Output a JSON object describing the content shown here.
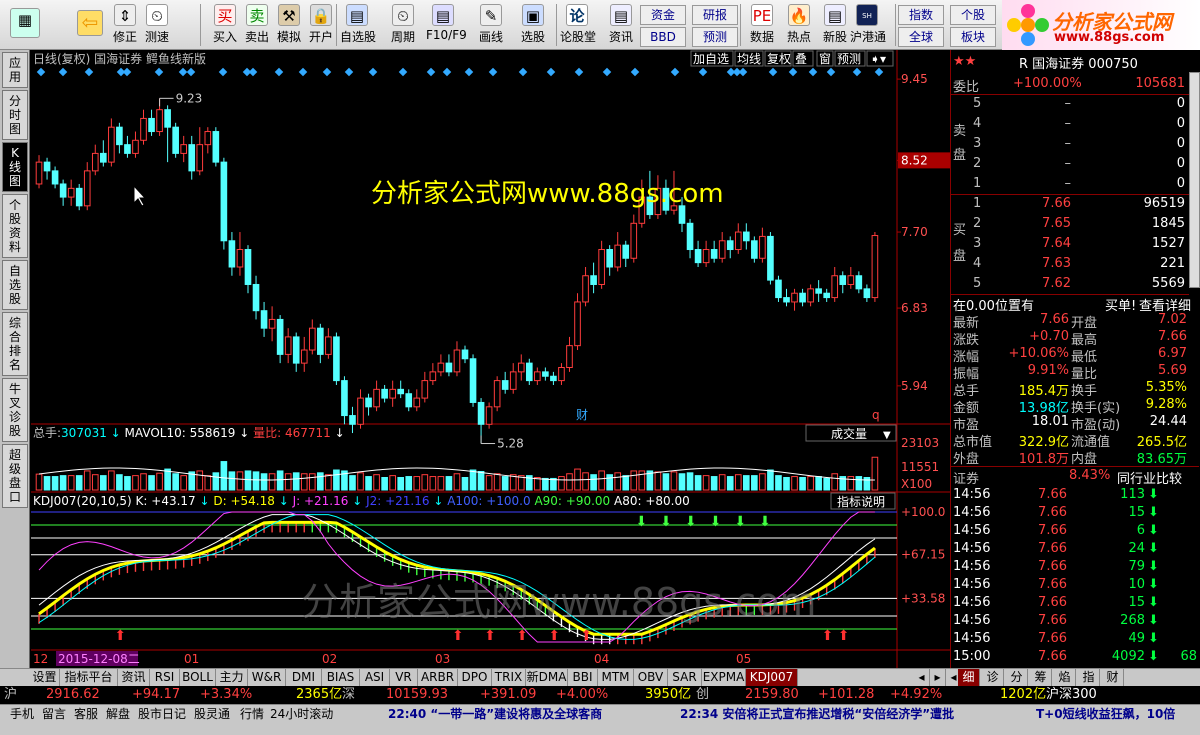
{
  "toolbar": {
    "buttons": [
      {
        "label": "",
        "icon": "layout-icon"
      },
      {
        "label": "",
        "icon": "back-arrow-icon"
      },
      {
        "label": "修正",
        "icon": "up-down-icon"
      },
      {
        "label": "测速",
        "icon": "clock-icon"
      },
      {
        "label": "买入",
        "icon": "buy-icon",
        "glyph": "买"
      },
      {
        "label": "卖出",
        "icon": "sell-icon",
        "glyph": "卖"
      },
      {
        "label": "模拟",
        "icon": "hammer-icon"
      },
      {
        "label": "开户",
        "icon": "lock-icon"
      },
      {
        "label": "自选股",
        "icon": "watchlist-icon"
      },
      {
        "label": "周期",
        "icon": "period-clock-icon"
      },
      {
        "label": "F10/F9",
        "icon": "f10-icon"
      },
      {
        "label": "画线",
        "icon": "pen-icon"
      },
      {
        "label": "选股",
        "icon": "screen-icon"
      },
      {
        "label": "论股堂",
        "icon": "forum-icon",
        "glyph": "论"
      },
      {
        "label": "资讯",
        "icon": "news-icon"
      },
      {
        "label": "数据",
        "icon": "pe-data-icon",
        "glyph": "PE"
      },
      {
        "label": "热点",
        "icon": "hot-icon"
      },
      {
        "label": "新股",
        "icon": "new-stock-icon"
      },
      {
        "label": "沪港通",
        "icon": "hk-connect-icon",
        "glyph": "SH HK"
      }
    ],
    "small": [
      "资金",
      "BBD",
      "研报",
      "预测",
      "指数",
      "全球",
      "个股",
      "板块"
    ]
  },
  "logo": {
    "title": "分析家公式网",
    "url": "www.88gs.com"
  },
  "leftbar": [
    "应用",
    "分时图",
    "K线图",
    "个股资料",
    "自选股",
    "综合排名",
    "牛叉诊股",
    "超级盘口"
  ],
  "chart": {
    "title": "日线(复权)  国海证券  鳄鱼线新版",
    "buttons": [
      "加自选",
      "均线",
      "复权",
      "叠",
      "窗",
      "预测"
    ],
    "price_axis": [
      "9.45",
      "8.52",
      "7.70",
      "6.83",
      "5.94"
    ],
    "current_price_label": "8.52",
    "high_label": "9.23",
    "low_label": "5.28",
    "watermark": "分析家公式网www.88gs.com",
    "watermark2": "分析家公式网www.88gs.com",
    "fin_mark": "财",
    "q_mark": "q",
    "volume_header": {
      "label1": "总手:",
      "val1": "307031",
      "label2": "MAVOL10:",
      "val2": "558619",
      "label3": "量比:",
      "val3": "467711"
    },
    "volume_dropdown": "成交量",
    "volume_axis": [
      "23103",
      "11551",
      "X100"
    ],
    "kdj_header": {
      "name": "KDJ007(20,10,5)",
      "k": "K: +43.17",
      "d": "D: +54.18",
      "j": "J: +21.16",
      "j2": "J2: +21.16",
      "a100": "A100: +100.0",
      "a90": "A90: +90.00",
      "a80": "A80: +80.00"
    },
    "indicator_help": "指标说明",
    "kdj_axis": [
      "+100.0",
      "+67.15",
      "+33.58"
    ],
    "date_axis": [
      "12",
      "2015-12-08二",
      "01",
      "02",
      "03",
      "04",
      "05"
    ]
  },
  "chart_data": {
    "type": "candlestick",
    "ylim": [
      5.0,
      9.6
    ],
    "candles": [
      [
        8.25,
        8.5,
        8.58,
        8.2
      ],
      [
        8.5,
        8.4,
        8.55,
        8.3
      ],
      [
        8.4,
        8.25,
        8.45,
        8.2
      ],
      [
        8.25,
        8.1,
        8.3,
        8.0
      ],
      [
        8.1,
        8.2,
        8.3,
        8.0
      ],
      [
        8.2,
        8.0,
        8.25,
        7.95
      ],
      [
        8.0,
        8.4,
        8.5,
        7.95
      ],
      [
        8.4,
        8.6,
        8.7,
        8.35
      ],
      [
        8.6,
        8.5,
        8.75,
        8.45
      ],
      [
        8.5,
        8.9,
        9.0,
        8.45
      ],
      [
        8.9,
        8.7,
        8.95,
        8.6
      ],
      [
        8.7,
        8.6,
        8.8,
        8.55
      ],
      [
        8.6,
        8.75,
        8.85,
        8.55
      ],
      [
        8.75,
        9.0,
        9.1,
        8.7
      ],
      [
        9.0,
        8.85,
        9.1,
        8.8
      ],
      [
        8.85,
        9.1,
        9.23,
        8.8
      ],
      [
        9.1,
        8.9,
        9.15,
        8.5
      ],
      [
        8.9,
        8.6,
        8.95,
        8.55
      ],
      [
        8.6,
        8.7,
        8.8,
        8.5
      ],
      [
        8.7,
        8.4,
        8.8,
        8.3
      ],
      [
        8.4,
        8.7,
        8.9,
        8.35
      ],
      [
        8.7,
        8.85,
        8.9,
        8.6
      ],
      [
        8.85,
        8.5,
        8.9,
        8.45
      ],
      [
        8.5,
        7.6,
        8.55,
        7.5
      ],
      [
        7.6,
        7.3,
        7.7,
        7.2
      ],
      [
        7.3,
        7.5,
        7.7,
        7.2
      ],
      [
        7.5,
        7.1,
        7.55,
        7.0
      ],
      [
        7.1,
        6.8,
        7.2,
        6.7
      ],
      [
        6.8,
        6.6,
        6.9,
        6.5
      ],
      [
        6.6,
        6.7,
        6.85,
        6.45
      ],
      [
        6.7,
        6.3,
        6.75,
        6.2
      ],
      [
        6.3,
        6.5,
        6.6,
        6.2
      ],
      [
        6.5,
        6.2,
        6.55,
        6.1
      ],
      [
        6.2,
        6.35,
        6.5,
        6.1
      ],
      [
        6.35,
        6.6,
        6.7,
        6.3
      ],
      [
        6.6,
        6.3,
        6.65,
        6.2
      ],
      [
        6.3,
        6.5,
        6.6,
        6.25
      ],
      [
        6.5,
        6.0,
        6.55,
        5.95
      ],
      [
        6.0,
        5.6,
        6.05,
        5.5
      ],
      [
        5.6,
        5.5,
        5.7,
        5.4
      ],
      [
        5.5,
        5.8,
        5.9,
        5.45
      ],
      [
        5.8,
        5.7,
        5.85,
        5.6
      ],
      [
        5.7,
        5.9,
        6.0,
        5.65
      ],
      [
        5.9,
        5.8,
        5.95,
        5.75
      ],
      [
        5.8,
        5.9,
        6.0,
        5.7
      ],
      [
        5.9,
        5.85,
        6.0,
        5.8
      ],
      [
        5.85,
        5.7,
        5.9,
        5.65
      ],
      [
        5.7,
        5.8,
        5.9,
        5.65
      ],
      [
        5.8,
        6.0,
        6.1,
        5.75
      ],
      [
        6.0,
        6.1,
        6.2,
        5.95
      ],
      [
        6.1,
        6.2,
        6.3,
        6.05
      ],
      [
        6.2,
        6.1,
        6.3,
        6.05
      ],
      [
        6.1,
        6.35,
        6.45,
        6.05
      ],
      [
        6.35,
        6.25,
        6.4,
        6.2
      ],
      [
        6.25,
        5.75,
        6.3,
        5.7
      ],
      [
        5.75,
        5.5,
        5.8,
        5.28
      ],
      [
        5.5,
        5.7,
        5.75,
        5.45
      ],
      [
        5.7,
        6.0,
        6.05,
        5.65
      ],
      [
        6.0,
        5.9,
        6.1,
        5.85
      ],
      [
        5.9,
        6.1,
        6.2,
        5.85
      ],
      [
        6.1,
        6.2,
        6.3,
        6.0
      ],
      [
        6.2,
        6.0,
        6.25,
        5.95
      ],
      [
        6.0,
        6.1,
        6.15,
        5.95
      ],
      [
        6.1,
        6.05,
        6.15,
        6.0
      ],
      [
        6.05,
        6.0,
        6.1,
        5.95
      ],
      [
        6.0,
        6.15,
        6.2,
        5.95
      ],
      [
        6.15,
        6.4,
        6.5,
        6.1
      ],
      [
        6.4,
        6.9,
        7.0,
        6.35
      ],
      [
        6.9,
        7.2,
        7.3,
        6.85
      ],
      [
        7.2,
        7.1,
        7.35,
        7.0
      ],
      [
        7.1,
        7.5,
        7.6,
        7.05
      ],
      [
        7.5,
        7.3,
        7.55,
        7.2
      ],
      [
        7.3,
        7.55,
        7.7,
        7.25
      ],
      [
        7.55,
        7.4,
        7.6,
        7.3
      ],
      [
        7.4,
        7.8,
        7.9,
        7.35
      ],
      [
        7.8,
        8.1,
        8.3,
        7.75
      ],
      [
        8.1,
        7.9,
        8.4,
        7.85
      ],
      [
        7.9,
        8.2,
        8.35,
        7.85
      ],
      [
        8.2,
        7.95,
        8.3,
        7.9
      ],
      [
        7.95,
        8.0,
        8.4,
        7.9
      ],
      [
        8.0,
        7.8,
        8.1,
        7.7
      ],
      [
        7.8,
        7.5,
        7.85,
        7.4
      ],
      [
        7.5,
        7.35,
        7.6,
        7.3
      ],
      [
        7.35,
        7.5,
        7.6,
        7.3
      ],
      [
        7.5,
        7.4,
        7.6,
        7.35
      ],
      [
        7.4,
        7.6,
        7.7,
        7.35
      ],
      [
        7.6,
        7.5,
        7.65,
        7.4
      ],
      [
        7.5,
        7.7,
        7.8,
        7.45
      ],
      [
        7.7,
        7.6,
        7.8,
        7.5
      ],
      [
        7.6,
        7.4,
        7.65,
        7.35
      ],
      [
        7.4,
        7.65,
        7.75,
        7.35
      ],
      [
        7.65,
        7.15,
        7.7,
        7.1
      ],
      [
        7.15,
        6.95,
        7.2,
        6.9
      ],
      [
        6.95,
        6.9,
        7.05,
        6.85
      ],
      [
        6.9,
        7.0,
        7.05,
        6.8
      ],
      [
        7.0,
        6.9,
        7.05,
        6.85
      ],
      [
        6.9,
        7.05,
        7.1,
        6.85
      ],
      [
        7.05,
        7.0,
        7.15,
        6.9
      ],
      [
        7.0,
        6.95,
        7.05,
        6.9
      ],
      [
        6.95,
        7.2,
        7.3,
        6.9
      ],
      [
        7.2,
        7.1,
        7.25,
        7.0
      ],
      [
        7.1,
        7.2,
        7.3,
        7.05
      ],
      [
        7.2,
        7.05,
        7.25,
        7.0
      ],
      [
        7.05,
        6.95,
        7.1,
        6.9
      ],
      [
        6.95,
        7.66,
        7.7,
        6.9
      ]
    ]
  },
  "quote": {
    "stars": "★★",
    "stock_name": "R 国海证券 000750",
    "weibi_label": "委比",
    "weibi_val": "+100.00%",
    "weibi_num": "105681",
    "sell_label": "卖盘",
    "buy_label": "买盘",
    "sells": [
      {
        "lv": "5",
        "p": "–",
        "v": "0"
      },
      {
        "lv": "4",
        "p": "–",
        "v": "0"
      },
      {
        "lv": "3",
        "p": "–",
        "v": "0"
      },
      {
        "lv": "2",
        "p": "–",
        "v": "0"
      },
      {
        "lv": "1",
        "p": "–",
        "v": "0"
      }
    ],
    "buys": [
      {
        "lv": "1",
        "p": "7.66",
        "v": "96519"
      },
      {
        "lv": "2",
        "p": "7.65",
        "v": "1845"
      },
      {
        "lv": "3",
        "p": "7.64",
        "v": "1527"
      },
      {
        "lv": "4",
        "p": "7.63",
        "v": "221"
      },
      {
        "lv": "5",
        "p": "7.62",
        "v": "5569"
      }
    ],
    "position_note": "在0.00位置有",
    "buy_note": "买单!",
    "detail": "查看详细",
    "stats": [
      {
        "l1": "最新",
        "v1": "7.66",
        "c1": "red",
        "l2": "开盘",
        "v2": "7.02",
        "c2": "red"
      },
      {
        "l1": "涨跌",
        "v1": "+0.70",
        "c1": "red",
        "l2": "最高",
        "v2": "7.66",
        "c2": "red"
      },
      {
        "l1": "涨幅",
        "v1": "+10.06%",
        "c1": "red",
        "l2": "最低",
        "v2": "6.97",
        "c2": "red"
      },
      {
        "l1": "振幅",
        "v1": "9.91%",
        "c1": "red",
        "l2": "量比",
        "v2": "5.69",
        "c2": "red"
      },
      {
        "l1": "总手",
        "v1": "185.4万",
        "c1": "yel",
        "l2": "换手",
        "v2": "5.35%",
        "c2": "yel"
      },
      {
        "l1": "金额",
        "v1": "13.98亿",
        "c1": "cyn",
        "l2": "换手(实)",
        "v2": "9.28%",
        "c2": "yel"
      },
      {
        "l1": "市盈",
        "v1": "18.01",
        "c1": "wht",
        "l2": "市盈(动)",
        "v2": "24.44",
        "c2": "wht"
      },
      {
        "l1": "总市值",
        "v1": "322.9亿",
        "c1": "yel",
        "l2": "流通值",
        "v2": "265.5亿",
        "c2": "yel"
      },
      {
        "l1": "外盘",
        "v1": "101.8万",
        "c1": "red",
        "l2": "内盘",
        "v2": "83.65万",
        "c2": "grn"
      }
    ],
    "sector": "证券",
    "sector_pct": "8.43%",
    "compare": "同行业比较",
    "ticks": [
      {
        "t": "14:56",
        "p": "7.66",
        "v": "113"
      },
      {
        "t": "14:56",
        "p": "7.66",
        "v": "15"
      },
      {
        "t": "14:56",
        "p": "7.66",
        "v": "6"
      },
      {
        "t": "14:56",
        "p": "7.66",
        "v": "24"
      },
      {
        "t": "14:56",
        "p": "7.66",
        "v": "79"
      },
      {
        "t": "14:56",
        "p": "7.66",
        "v": "10"
      },
      {
        "t": "14:56",
        "p": "7.66",
        "v": "15"
      },
      {
        "t": "14:56",
        "p": "7.66",
        "v": "268"
      },
      {
        "t": "14:56",
        "p": "7.66",
        "v": "49"
      },
      {
        "t": "15:00",
        "p": "7.66",
        "v": "4092",
        "v2": "68"
      }
    ]
  },
  "tabs": [
    "设置",
    "指标平台",
    "资讯",
    "RSI",
    "BOLL",
    "主力",
    "W&R",
    "DMI",
    "BIAS",
    "ASI",
    "VR",
    "ARBR",
    "DPO",
    "TRIX",
    "新DMA",
    "BBI",
    "MTM",
    "OBV",
    "SAR",
    "EXPMA",
    "KDJ007"
  ],
  "right_tabs": [
    "细",
    "诊",
    "分",
    "筹",
    "焰",
    "指",
    "财"
  ],
  "index_bar": {
    "sh_label": "沪",
    "sh": "2916.62",
    "sh_chg": "+94.17",
    "sh_pct": "+3.34%",
    "sh_amt": "2365亿",
    "sz_label": "深",
    "sz": "10159.93",
    "sz_chg": "+391.09",
    "sz_pct": "+4.00%",
    "sz_amt": "3950亿",
    "cy_label": "创",
    "cy": "2159.80",
    "cy_chg": "+101.28",
    "cy_pct": "+4.92%",
    "cy_amt": "1202亿",
    "hs_label": "沪深300"
  },
  "status": {
    "items": [
      "手机",
      "留言",
      "客服",
      "解盘",
      "股市日记",
      "股灵通",
      "行情",
      "24小时滚动"
    ],
    "news1": "22:40 “一带一路”建设将惠及全球客商",
    "news2": "22:34 安倍将正式宣布推迟增税“安倍经济学”遭批",
    "news3": "T+0短线收益狂飙，10倍"
  }
}
